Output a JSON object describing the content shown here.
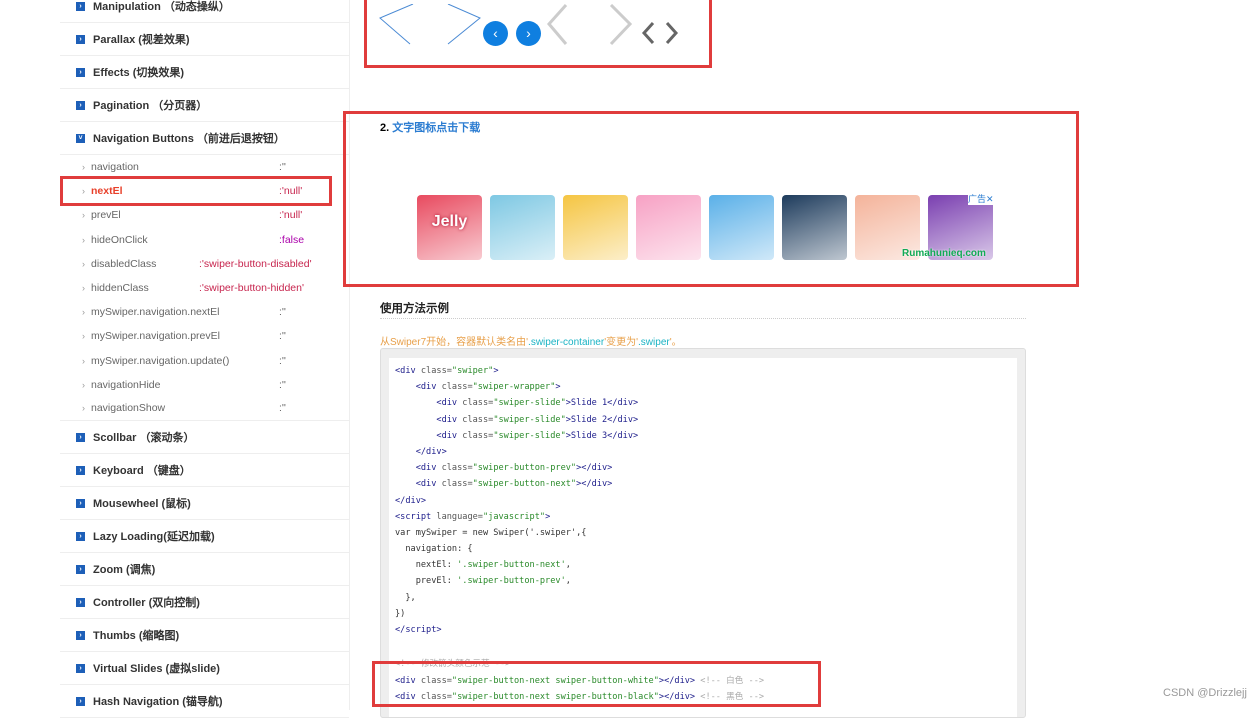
{
  "sidebar": {
    "sections_top": [
      {
        "label": "Manipulation （动态操纵）"
      },
      {
        "label": "Parallax (视差效果)"
      },
      {
        "label": "Effects (切换效果)"
      },
      {
        "label": "Pagination （分页器）"
      },
      {
        "label": "Navigation Buttons （前进后退按钮）"
      }
    ],
    "sub_items": [
      {
        "name": "navigation",
        "value": ":''"
      },
      {
        "name": "nextEl",
        "value": ":'null'"
      },
      {
        "name": "prevEl",
        "value": ":'null'"
      },
      {
        "name": "hideOnClick",
        "value": ":false"
      },
      {
        "name": "disabledClass",
        "value": ":'swiper-button-disabled'"
      },
      {
        "name": "hiddenClass",
        "value": ":'swiper-button-hidden'"
      },
      {
        "name": "mySwiper.navigation.nextEl",
        "value": ":''"
      },
      {
        "name": "mySwiper.navigation.prevEl",
        "value": ":''"
      },
      {
        "name": "mySwiper.navigation.update()",
        "value": ":''"
      },
      {
        "name": "navigationHide",
        "value": ":''"
      },
      {
        "name": "navigationShow",
        "value": ":''"
      }
    ],
    "sections_bottom": [
      {
        "label": "Scollbar （滚动条）"
      },
      {
        "label": "Keyboard （键盘）"
      },
      {
        "label": "Mousewheel (鼠标)"
      },
      {
        "label": "Lazy Loading(延迟加载)"
      },
      {
        "label": "Zoom (调焦)"
      },
      {
        "label": "Controller (双向控制)"
      },
      {
        "label": "Thumbs (缩略图)"
      },
      {
        "label": "Virtual Slides (虚拟slide)"
      },
      {
        "label": "Hash Navigation (锚导航)"
      }
    ]
  },
  "ad": {
    "heading_num": "2.",
    "heading_link": "文字图标点击下载",
    "tag": "广告✕",
    "url": "Rumahunieq.com",
    "tiles": [
      "#e84a5f",
      "#7ec8e3",
      "#f5c542",
      "#f7a1c4",
      "#5ab0e8",
      "#1d3b5c",
      "#f4b39a",
      "#7a3fb0"
    ],
    "jelly": "Jelly"
  },
  "usage": {
    "title": "使用方法示例",
    "note_a": "从Swiper7开始，容器默认类名由'",
    "note_b": ".swiper-container",
    "note_c": "'变更为'",
    "note_d": ".swiper",
    "note_e": "'。"
  },
  "code": {
    "l1a": "<div ",
    "l1b": "class=",
    "l1c": "\"swiper\"",
    "l1d": ">",
    "l2a": "    <div ",
    "l2c": "\"swiper-wrapper\"",
    "l3a": "        <div ",
    "l3c": "\"swiper-slide\"",
    "l3d": ">Slide 1</div>",
    "l4d": ">Slide 2</div>",
    "l5d": ">Slide 3</div>",
    "l6": "    </div>",
    "l7c": "\"swiper-button-prev\"",
    "l8c": "\"swiper-button-next\"",
    "close": "></div>",
    "l9": "</div>",
    "l10a": "<script ",
    "l10b": "language=",
    "l10c": "\"javascript\"",
    "l11": "var mySwiper = new Swiper('.swiper',{",
    "l12": "  navigation: {",
    "l13a": "    nextEl: ",
    "l13b": "'.swiper-button-next'",
    "l14a": "    prevEl: ",
    "l14b": "'.swiper-button-prev'",
    "l15": "  },",
    "l16": "})",
    "l17": "</script>",
    "l18": "<!-- 修改箭头颜色示范 -->",
    "l19c": "\"swiper-button-next swiper-button-white\"",
    "l19e": " <!-- 白色 -->",
    "l20c": "\"swiper-button-next swiper-button-black\"",
    "l20e": " <!-- 黑色 -->",
    "comma": ","
  },
  "watermark": "CSDN @Drizzlejj",
  "nav_demo": {
    "prev": "‹",
    "next": "›"
  }
}
